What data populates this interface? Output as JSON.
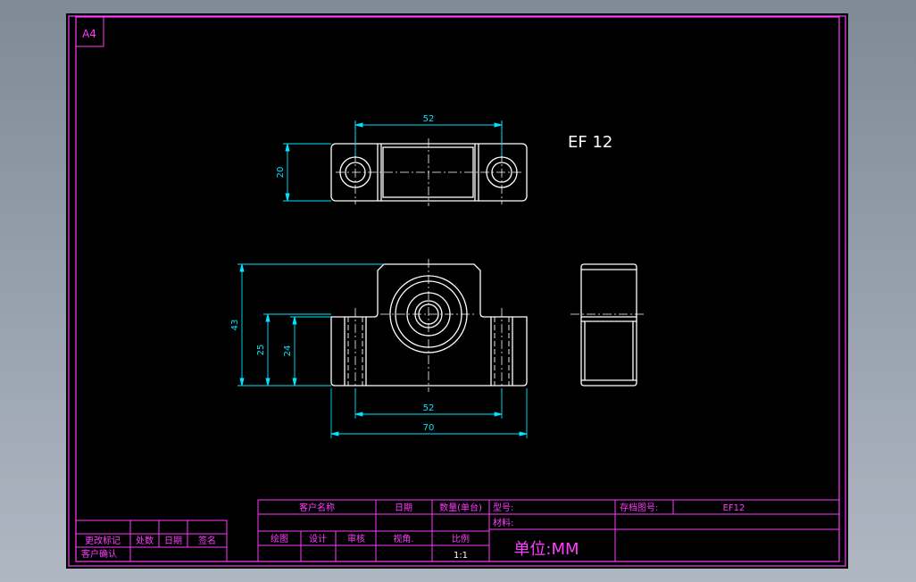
{
  "sheet": {
    "size_label": "A4"
  },
  "part": {
    "name": "EF 12"
  },
  "dimensions": {
    "top_hole_spacing": "52",
    "top_depth": "20",
    "front_height": "43",
    "front_hole_height": "25",
    "front_center_height": "24",
    "front_hole_spacing": "52",
    "front_length": "70"
  },
  "title_block": {
    "customer_name": "客户名称",
    "date": "日期",
    "quantity": "数量(单台)",
    "model_no": "型号:",
    "storage_drawing_no": "存档图号:",
    "drawing_no_value": "EF12",
    "material": "材料:",
    "drawn": "绘图",
    "design": "设计",
    "review": "审核",
    "view_angle": "视角.",
    "scale_label": "比例",
    "scale_value": "1:1",
    "unit": "单位:MM",
    "change_mark": "更改标记",
    "change_count": "处数",
    "change_date": "日期",
    "signature": "签名",
    "customer_confirm": "客户确认"
  },
  "colors": {
    "background_gradient_top": "#7f8a97",
    "sheet": "#000000",
    "border": "#ff3cff",
    "outline": "#ffffff",
    "dimension": "#00e5ff",
    "center_line": "#ffffff"
  }
}
